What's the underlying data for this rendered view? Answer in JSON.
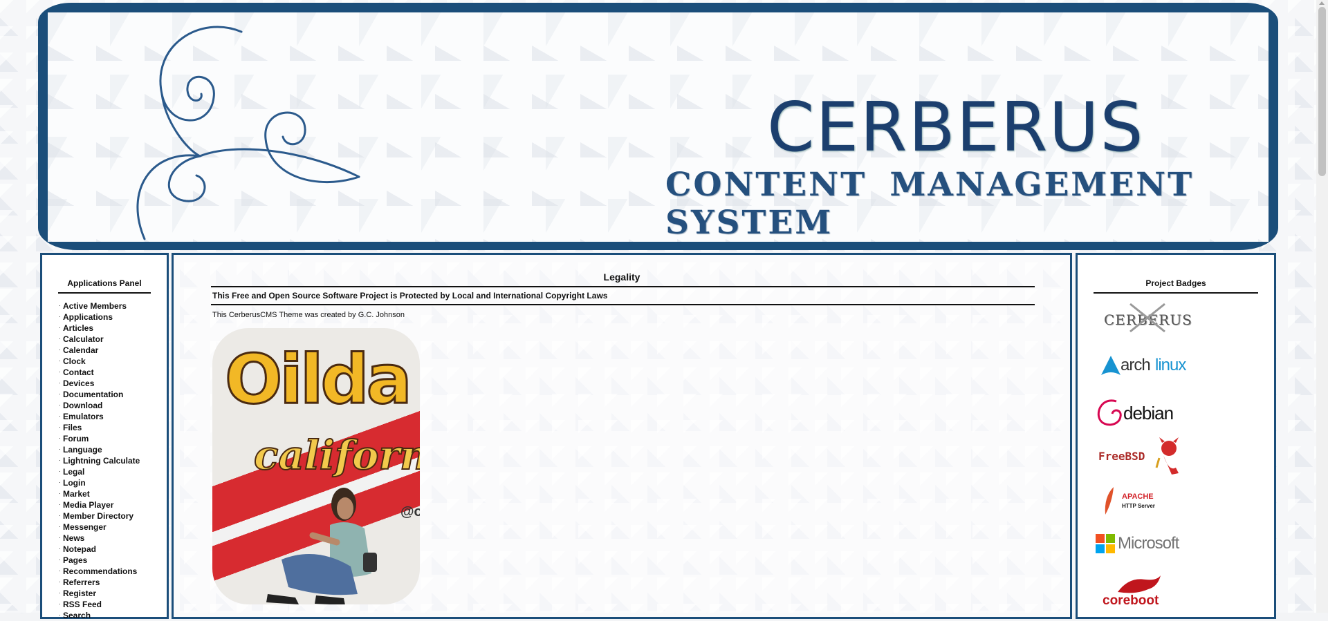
{
  "header": {
    "title": "CERBERUS",
    "subtitle": "CONTENT MANAGEMENT SYSTEM",
    "brand_color": "#1b4e7a"
  },
  "left_panel": {
    "title": "Applications Panel",
    "items": [
      {
        "label": "Active Members"
      },
      {
        "label": "Applications"
      },
      {
        "label": "Articles"
      },
      {
        "label": "Calculator"
      },
      {
        "label": "Calendar"
      },
      {
        "label": "Clock"
      },
      {
        "label": "Contact"
      },
      {
        "label": "Devices"
      },
      {
        "label": "Documentation"
      },
      {
        "label": "Download"
      },
      {
        "label": "Emulators"
      },
      {
        "label": "Files"
      },
      {
        "label": "Forum"
      },
      {
        "label": "Language"
      },
      {
        "label": "Lightning Calculate"
      },
      {
        "label": "Legal"
      },
      {
        "label": "Login"
      },
      {
        "label": "Market"
      },
      {
        "label": "Media Player"
      },
      {
        "label": "Member Directory"
      },
      {
        "label": "Messenger"
      },
      {
        "label": "News"
      },
      {
        "label": "Notepad"
      },
      {
        "label": "Pages"
      },
      {
        "label": "Recommendations"
      },
      {
        "label": "Referrers"
      },
      {
        "label": "Register"
      },
      {
        "label": "RSS Feed"
      },
      {
        "label": "Search"
      }
    ]
  },
  "main": {
    "title": "Legality",
    "notice": "This Free and Open Source Software Project is Protected by Local and International Copyright Laws",
    "credit": "This CerberusCMS Theme was created by G.C. Johnson",
    "photo": {
      "text_line1": "Oilda",
      "text_line2": "californ",
      "wall_text": "@o"
    }
  },
  "right_panel": {
    "title": "Project Badges",
    "badges": [
      {
        "name": "cerberus-badge",
        "text": "CERBERUS"
      },
      {
        "name": "archlinux-badge",
        "text_a": "arch",
        "text_b": "linux",
        "color": "#1793d1"
      },
      {
        "name": "debian-badge",
        "text": "debian",
        "color": "#d70751"
      },
      {
        "name": "freebsd-badge",
        "text": "FreeBSD",
        "color": "#ab2b28"
      },
      {
        "name": "apache-badge",
        "text_a": "APACHE",
        "text_b": "HTTP Server",
        "color": "#d22128"
      },
      {
        "name": "microsoft-badge",
        "text": "Microsoft",
        "color": "#737373"
      },
      {
        "name": "coreboot-badge",
        "text": "coreboot",
        "color": "#c0161d"
      }
    ]
  }
}
